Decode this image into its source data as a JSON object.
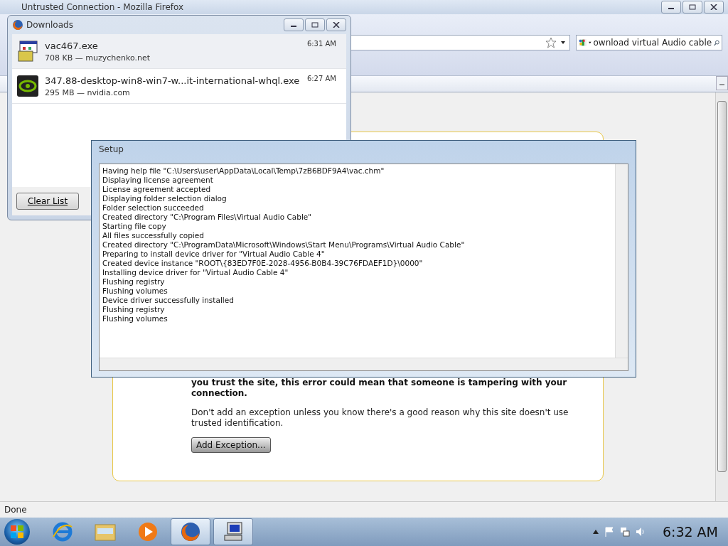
{
  "browser": {
    "title": "Untrusted Connection - Mozilla Firefox",
    "search": {
      "value": "ownload virtual Audio cable"
    },
    "page": {
      "warning": "you trust the site, this error could mean that someone is tampering with your connection.",
      "advice": "Don't add an exception unless you know there's a good reason why this site doesn't use trusted identification.",
      "button": "Add Exception..."
    },
    "status": "Done"
  },
  "downloads": {
    "title": "Downloads",
    "items": [
      {
        "name": "vac467.exe",
        "details": "708 KB — muzychenko.net",
        "time": "6:31 AM",
        "kind": "archive",
        "selected": true
      },
      {
        "name": "347.88-desktop-win8-win7-w...it-international-whql.exe",
        "details": "295 MB — nvidia.com",
        "time": "6:27 AM",
        "kind": "driver",
        "selected": false
      }
    ],
    "clear_button": "Clear List"
  },
  "setup": {
    "title": "Setup",
    "log": [
      "Having help file \"C:\\Users\\user\\AppData\\Local\\Temp\\7zB6BDF9A4\\vac.chm\"",
      "Displaying license agreement",
      "License agreement accepted",
      "Displaying folder selection dialog",
      "Folder selection succeeded",
      "Created directory \"C:\\Program Files\\Virtual Audio Cable\"",
      "Starting file copy",
      "All files successfully copied",
      "Created directory \"C:\\ProgramData\\Microsoft\\Windows\\Start Menu\\Programs\\Virtual Audio Cable\"",
      "Preparing to install device driver for \"Virtual Audio Cable 4\"",
      "Created device instance \"ROOT\\{83ED7F0E-2028-4956-B0B4-39C76FDAEF1D}\\0000\"",
      "Installing device driver for \"Virtual Audio Cable 4\"",
      "Flushing registry",
      "Flushing volumes",
      "Device driver successfully installed",
      "Flushing registry",
      "Flushing volumes"
    ]
  },
  "taskbar": {
    "apps": [
      {
        "kind": "ie",
        "active": false
      },
      {
        "kind": "folder",
        "active": false
      },
      {
        "kind": "media",
        "active": false
      },
      {
        "kind": "firefox",
        "active": true
      },
      {
        "kind": "setup",
        "active": true
      }
    ],
    "clock": "6:32 AM"
  }
}
